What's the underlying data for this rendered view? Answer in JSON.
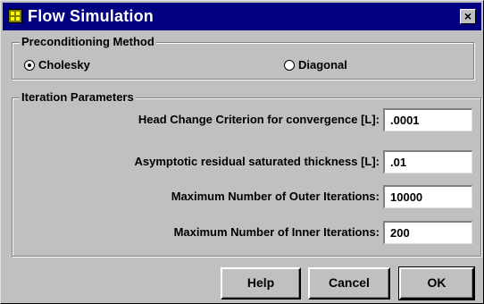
{
  "window": {
    "title": "Flow Simulation",
    "close_glyph": "×"
  },
  "preconditioning": {
    "title": "Preconditioning Method",
    "options": [
      {
        "label": "Cholesky",
        "selected": true
      },
      {
        "label": "Diagonal",
        "selected": false
      }
    ]
  },
  "iteration": {
    "title": "Iteration Parameters",
    "rows": [
      {
        "label": "Head Change Criterion for convergence [L]:",
        "value": ".0001"
      },
      {
        "label": "Asymptotic residual saturated thickness [L]:",
        "value": ".01"
      },
      {
        "label": "Maximum Number of Outer Iterations:",
        "value": "10000"
      },
      {
        "label": "Maximum Number of Inner Iterations:",
        "value": "200"
      }
    ]
  },
  "buttons": {
    "help": "Help",
    "cancel": "Cancel",
    "ok": "OK"
  }
}
